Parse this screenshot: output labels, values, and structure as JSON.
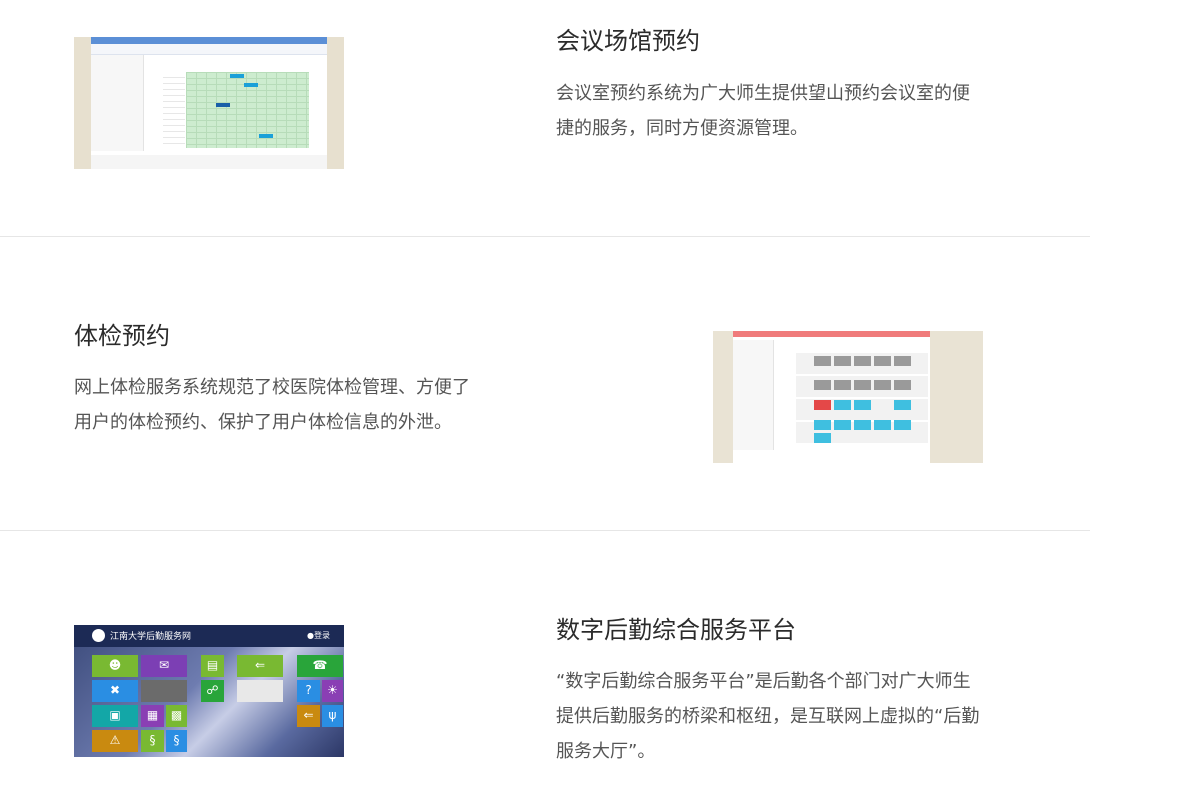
{
  "sections": [
    {
      "title": "会议场馆预约",
      "description": "会议室预约系统为广大师生提供望山预约会议室的便捷的服务，同时方便资源管理。",
      "thumbnail": "meeting-venue-screenshot"
    },
    {
      "title": "体检预约",
      "description": "网上体检服务系统规范了校医院体检管理、方便了用户的体检预约、保护了用户体检信息的外泄。",
      "thumbnail": "health-check-screenshot"
    },
    {
      "title": "数字后勤综合服务平台",
      "description": "“数字后勤综合服务平台”是后勤各个部门对广大师生提供后勤服务的桥梁和枢纽，是互联网上虚拟的“后勤服务大厅”。",
      "thumbnail": "logistics-platform-screenshot",
      "preview": {
        "header": "江南大学后勤服务网",
        "user": "登录"
      }
    }
  ],
  "colors": {
    "divider": "#e6e6e6",
    "title": "#2b2b2b",
    "text": "#555555"
  }
}
